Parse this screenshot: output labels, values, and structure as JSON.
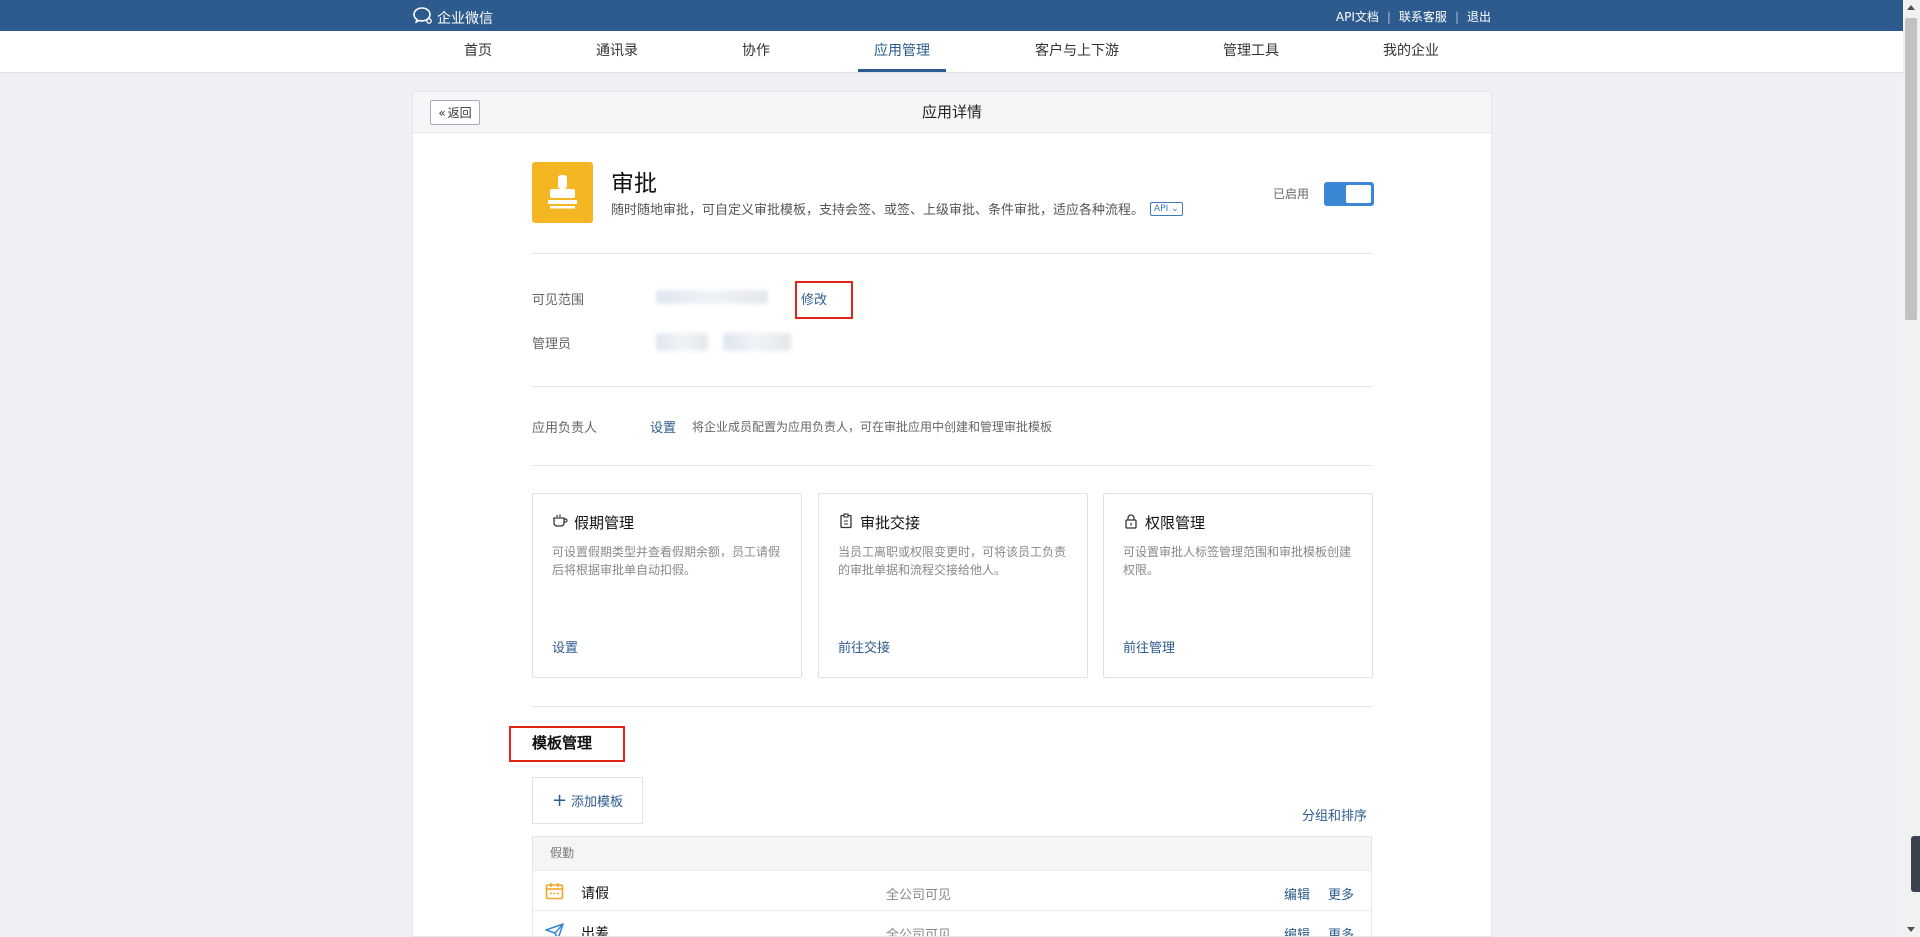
{
  "topbar": {
    "logo_text": "企业微信",
    "links": [
      {
        "label": "API文档"
      },
      {
        "label": "联系客服"
      },
      {
        "label": "退出"
      }
    ]
  },
  "nav": {
    "items": [
      {
        "label": "首页"
      },
      {
        "label": "通讯录"
      },
      {
        "label": "协作"
      },
      {
        "label": "应用管理",
        "active": true
      },
      {
        "label": "客户与上下游"
      },
      {
        "label": "管理工具"
      },
      {
        "label": "我的企业"
      }
    ]
  },
  "panel": {
    "back_label": "返回",
    "title": "应用详情"
  },
  "app": {
    "name": "审批",
    "description": "随时随地审批，可自定义审批模板，支持会签、或签、上级审批、条件审批，适应各种流程。",
    "api_badge": "API",
    "status_label": "已启用",
    "enabled": true,
    "icon": "stamp-icon",
    "icon_color": "#f4b623"
  },
  "fields": {
    "visible_range_label": "可见范围",
    "modify_label": "修改",
    "admin_label": "管理员",
    "owner_label": "应用负责人",
    "owner_set_label": "设置",
    "owner_hint": "将企业成员配置为应用负责人，可在审批应用中创建和管理审批模板"
  },
  "cards": [
    {
      "title": "假期管理",
      "icon": "cup-icon",
      "desc": "可设置假期类型并查看假期余额，员工请假后将根据审批单自动扣假。",
      "link": "设置"
    },
    {
      "title": "审批交接",
      "icon": "clipboard-icon",
      "desc": "当员工离职或权限变更时，可将该员工负责的审批单据和流程交接给他人。",
      "link": "前往交接"
    },
    {
      "title": "权限管理",
      "icon": "lock-icon",
      "desc": "可设置审批人标签管理范围和审批模板创建权限。",
      "link": "前往管理"
    }
  ],
  "templates": {
    "section_title": "模板管理",
    "add_label": "添加模板",
    "group_sort_label": "分组和排序",
    "groups": [
      {
        "name": "假勤",
        "rows": [
          {
            "name": "请假",
            "icon": "calendar-icon",
            "scope": "全公司可见",
            "edit": "编辑",
            "more": "更多"
          },
          {
            "name": "出差",
            "icon": "plane-icon",
            "scope": "全公司可见",
            "edit": "编辑",
            "more": "更多"
          }
        ]
      }
    ]
  },
  "colors": {
    "topbar": "#2d5b8e",
    "link": "#2d5b8e",
    "toggle_on": "#3b86d5",
    "highlight_box": "#e2231a"
  }
}
